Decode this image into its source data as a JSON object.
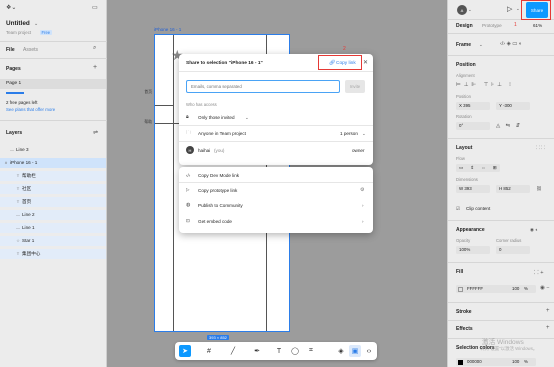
{
  "left": {
    "file_name": "Untitled",
    "team": "Team project",
    "plan": "Free",
    "tabs": [
      "File",
      "Assets"
    ],
    "pages_title": "Pages",
    "page_item": "Page 1",
    "pages_notice": "2 free pages left",
    "pages_link": "See plans that offer more",
    "layers_title": "Layers",
    "layers": [
      {
        "label": "Line 3",
        "indent": 1
      },
      {
        "label": "iPhone 16 - 1",
        "indent": 0,
        "selected": true
      },
      {
        "label": "帮助栏",
        "indent": 2
      },
      {
        "label": "社区",
        "indent": 2
      },
      {
        "label": "首页",
        "indent": 2
      },
      {
        "label": "Line 2",
        "indent": 2
      },
      {
        "label": "Line 1",
        "indent": 2
      },
      {
        "label": "Star 1",
        "indent": 2
      },
      {
        "label": "集团中心",
        "indent": 2
      }
    ]
  },
  "canvas": {
    "frame_label": "iPhone 16 - 1",
    "frame_size": "393 × 852",
    "frame_texts": [
      "首页",
      "帮助"
    ]
  },
  "modal": {
    "title": "Share to selection \"iPhone 16 - 1\"",
    "copy_link": "Copy link",
    "email_placeholder": "Emails, comma separated",
    "invite": "Invite",
    "who_has_access": "Who has access",
    "access_rows": [
      {
        "label": "Only those invited",
        "icon": "lock-icon"
      },
      {
        "label": "Anyone in Team project",
        "value": "1 person",
        "icon": "folder-icon"
      }
    ],
    "user": {
      "name": "haihai",
      "you": "(you)",
      "role": "owner",
      "initial": "H"
    },
    "actions": [
      {
        "label": "Copy Dev Mode link",
        "icon": "code-icon"
      },
      {
        "label": "Copy prototype link",
        "icon": "play-icon"
      },
      {
        "label": "Publish to Community",
        "icon": "globe-icon"
      },
      {
        "label": "Get embed code",
        "icon": "embed-icon"
      }
    ]
  },
  "annotations": {
    "num1": "1",
    "num2": "2"
  },
  "right": {
    "avatar_initial": "A",
    "share": "Share",
    "tabs": [
      "Design",
      "Prototype"
    ],
    "zoom": "61%",
    "frame_select": "Frame",
    "position_title": "Position",
    "alignment": "Alignment",
    "position_label": "Position",
    "x": "X 395",
    "y": "Y -300",
    "rotation_label": "Rotation",
    "rotation": "0°",
    "layout_title": "Layout",
    "flow": "Flow",
    "dimensions": "Dimensions",
    "w": "W 393",
    "h": "H 852",
    "clip": "Clip content",
    "appearance_title": "Appearance",
    "opacity_label": "Opacity",
    "corner_label": "Corner radius",
    "opacity": "100%",
    "corner": "0",
    "fill_title": "Fill",
    "fill_hex": "FFFFFF",
    "fill_pct": "100",
    "fill_pct_unit": "%",
    "stroke_title": "Stroke",
    "effects_title": "Effects",
    "selection_colors": "Selection colors",
    "sel_hex": "000000",
    "sel_pct": "100",
    "sel_pct_unit": "%",
    "fill_color": "#FFFFFF",
    "sel_color": "#000000"
  },
  "watermark": {
    "line1": "激活 Windows",
    "line2": "转到\"设置\"以激活 Windows。"
  }
}
